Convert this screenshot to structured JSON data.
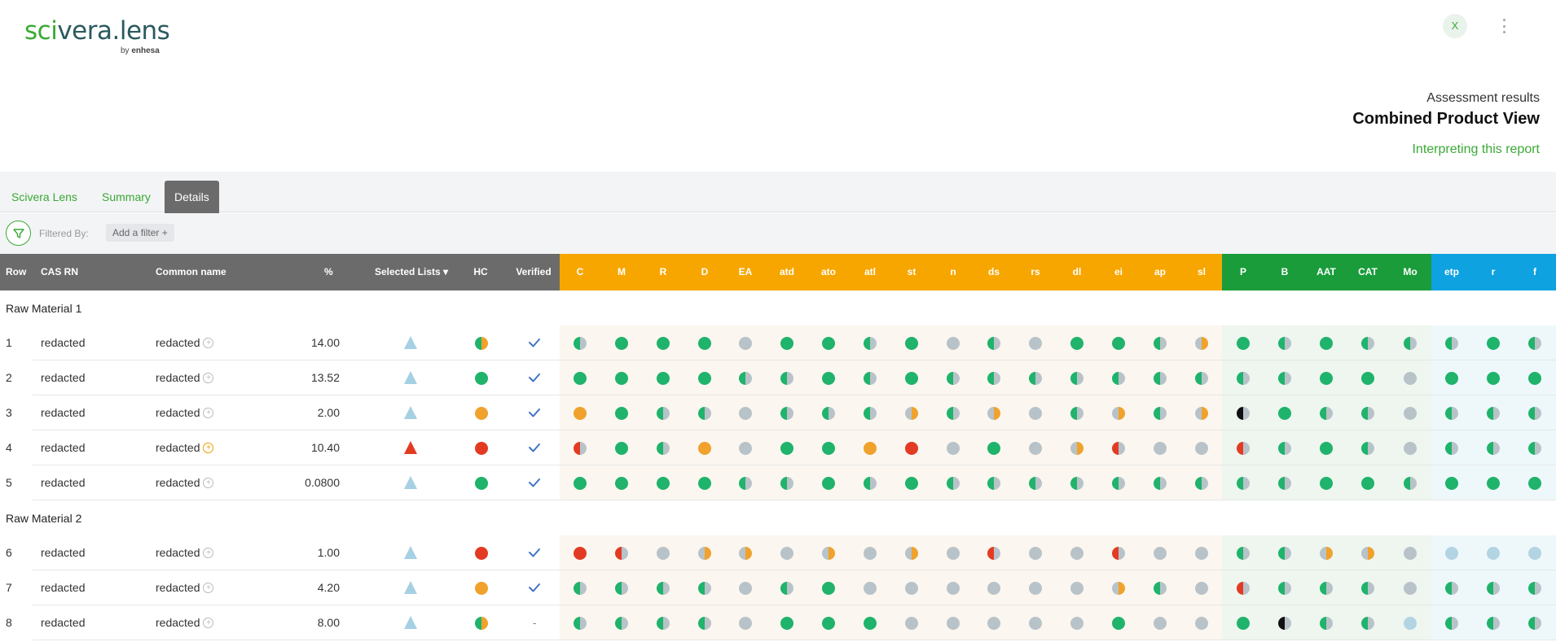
{
  "brand": {
    "logo_sci": "sci",
    "logo_rest": "vera.lens",
    "by_prefix": "by ",
    "by_name": "enhesa"
  },
  "user": {
    "initial": "X"
  },
  "report": {
    "subtitle": "Assessment results",
    "title": "Combined Product View",
    "interpret_link": "Interpreting this report"
  },
  "tabs": [
    {
      "label": "Scivera Lens",
      "active": false
    },
    {
      "label": "Summary",
      "active": false
    },
    {
      "label": "Details",
      "active": true
    }
  ],
  "filter": {
    "label": "Filtered By:",
    "add_label": "Add a filter +"
  },
  "columns": {
    "row": "Row",
    "cas": "CAS RN",
    "common": "Common name",
    "pct": "%",
    "lists": "Selected Lists ▾",
    "hc": "HC",
    "verified": "Verified",
    "hazards": [
      "C",
      "M",
      "R",
      "D",
      "EA",
      "atd",
      "ato",
      "atl",
      "st",
      "n",
      "ds",
      "rs",
      "dl",
      "ei",
      "ap",
      "sl",
      "P",
      "B",
      "AAT",
      "CAT",
      "Mo",
      "etp",
      "r",
      "f"
    ]
  },
  "colors": {
    "green": "#1fb36b",
    "grey": "#b8c3c9",
    "lightblue": "#b3d4e2",
    "orange": "#f0a22c",
    "red": "#e33b23",
    "black": "#111111",
    "brand_green": "#3aa935",
    "check_blue": "#3f74c6"
  },
  "legend_codes": {
    "G": "green",
    "g": "half green/grey",
    "o": "half orange/grey",
    "O": "orange",
    "R": "red",
    "r": "half red/grey",
    "b": "half black/grey",
    "L": "light blue",
    "y": "half grey/orange",
    "Y": "half green/orange",
    "N": "grey"
  },
  "groups": [
    {
      "label": "Raw Material 1",
      "rows": [
        {
          "row": "1",
          "cas": "redacted",
          "name": "redacted",
          "name_flag": false,
          "pct": "14.00",
          "list": "blue",
          "hc": "Y",
          "verified": true,
          "dots": [
            "g",
            "G",
            "G",
            "G",
            "N",
            "G",
            "G",
            "g",
            "G",
            "N",
            "g",
            "N",
            "G",
            "G",
            "g",
            "y",
            "G",
            "g",
            "G",
            "g",
            "g",
            "g",
            "G",
            "g"
          ]
        },
        {
          "row": "2",
          "cas": "redacted",
          "name": "redacted",
          "name_flag": false,
          "pct": "13.52",
          "list": "blue",
          "hc": "G",
          "verified": true,
          "dots": [
            "G",
            "G",
            "G",
            "G",
            "g",
            "g",
            "G",
            "g",
            "G",
            "g",
            "g",
            "g",
            "g",
            "g",
            "g",
            "g",
            "g",
            "g",
            "G",
            "G",
            "N",
            "G",
            "G",
            "G"
          ]
        },
        {
          "row": "3",
          "cas": "redacted",
          "name": "redacted",
          "name_flag": false,
          "pct": "2.00",
          "list": "blue",
          "hc": "O",
          "verified": true,
          "dots": [
            "O",
            "G",
            "g",
            "g",
            "N",
            "g",
            "g",
            "g",
            "y",
            "g",
            "y",
            "N",
            "g",
            "y",
            "g",
            "y",
            "b",
            "G",
            "g",
            "g",
            "N",
            "g",
            "g",
            "g"
          ]
        },
        {
          "row": "4",
          "cas": "redacted",
          "name": "redacted",
          "name_flag": true,
          "pct": "10.40",
          "list": "red",
          "hc": "R",
          "verified": true,
          "dots": [
            "r",
            "G",
            "g",
            "O",
            "N",
            "G",
            "G",
            "O",
            "R",
            "N",
            "G",
            "N",
            "y",
            "r",
            "N",
            "N",
            "r",
            "g",
            "G",
            "g",
            "N",
            "g",
            "g",
            "g"
          ]
        },
        {
          "row": "5",
          "cas": "redacted",
          "name": "redacted",
          "name_flag": false,
          "pct": "0.0800",
          "list": "blue",
          "hc": "G",
          "verified": true,
          "dots": [
            "G",
            "G",
            "G",
            "G",
            "g",
            "g",
            "G",
            "g",
            "G",
            "g",
            "g",
            "g",
            "g",
            "g",
            "g",
            "g",
            "g",
            "g",
            "G",
            "G",
            "g",
            "G",
            "G",
            "G"
          ]
        }
      ]
    },
    {
      "label": "Raw Material 2",
      "rows": [
        {
          "row": "6",
          "cas": "redacted",
          "name": "redacted",
          "name_flag": false,
          "pct": "1.00",
          "list": "blue",
          "hc": "R",
          "verified": true,
          "dots": [
            "R",
            "r",
            "N",
            "y",
            "y",
            "N",
            "y",
            "N",
            "y",
            "N",
            "r",
            "N",
            "N",
            "r",
            "N",
            "N",
            "g",
            "g",
            "y",
            "y",
            "N",
            "L",
            "L",
            "L"
          ]
        },
        {
          "row": "7",
          "cas": "redacted",
          "name": "redacted",
          "name_flag": false,
          "pct": "4.20",
          "list": "blue",
          "hc": "O",
          "verified": true,
          "dots": [
            "g",
            "g",
            "g",
            "g",
            "N",
            "g",
            "G",
            "N",
            "N",
            "N",
            "N",
            "N",
            "N",
            "y",
            "g",
            "N",
            "r",
            "g",
            "g",
            "g",
            "N",
            "g",
            "g",
            "g"
          ]
        },
        {
          "row": "8",
          "cas": "redacted",
          "name": "redacted",
          "name_flag": false,
          "pct": "8.00",
          "list": "blue",
          "hc": "Y",
          "verified": false,
          "dots": [
            "g",
            "g",
            "g",
            "g",
            "N",
            "G",
            "G",
            "G",
            "N",
            "N",
            "N",
            "N",
            "N",
            "G",
            "N",
            "N",
            "G",
            "b",
            "g",
            "g",
            "L",
            "g",
            "g",
            "g"
          ]
        }
      ]
    }
  ]
}
